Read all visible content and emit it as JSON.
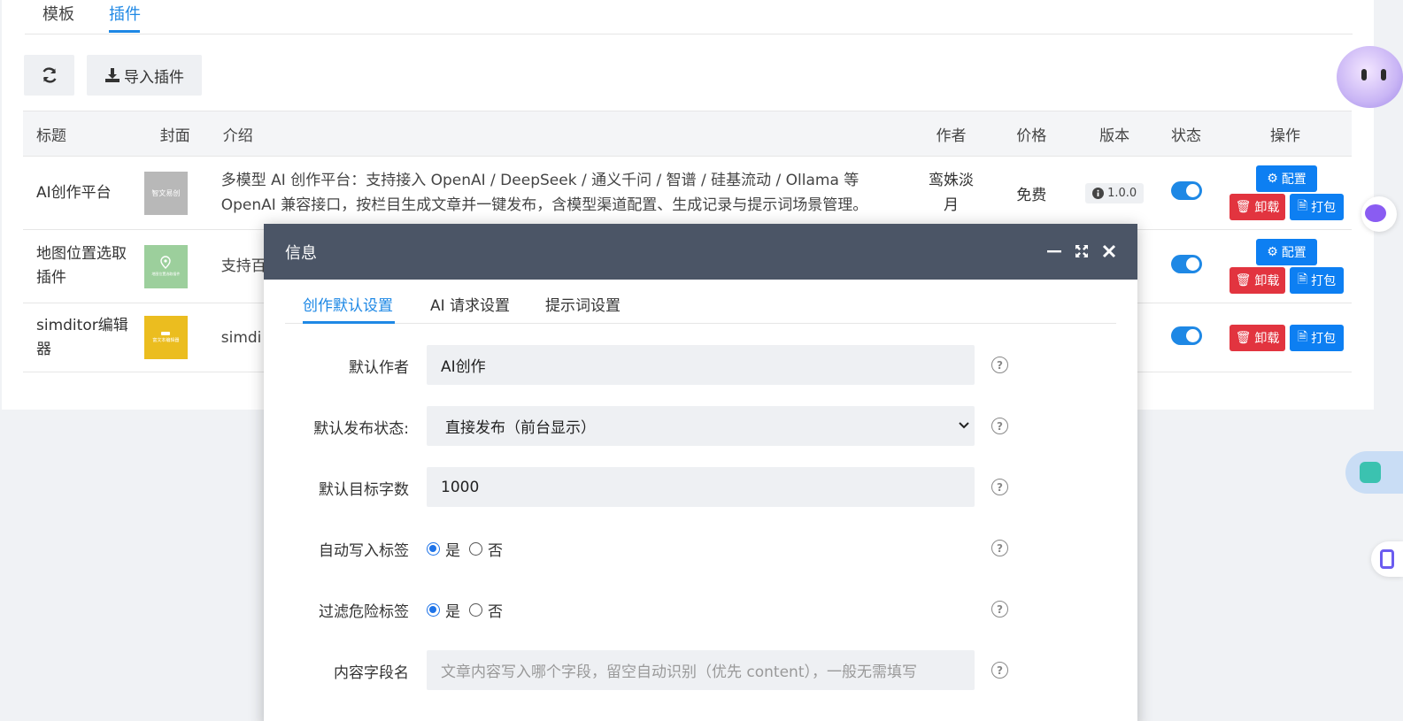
{
  "top_tabs": [
    {
      "label": "模板",
      "active": false
    },
    {
      "label": "插件",
      "active": true
    }
  ],
  "toolbar": {
    "refresh_icon": "refresh-icon",
    "import_label": "导入插件",
    "import_icon": "download-icon"
  },
  "table": {
    "headers": {
      "title": "标题",
      "cover": "封面",
      "intro": "介绍",
      "author": "作者",
      "price": "价格",
      "version": "版本",
      "status": "状态",
      "ops": "操作"
    },
    "rows": [
      {
        "title": "AI创作平台",
        "cover_color": "#b8b8b8",
        "cover_text": "智文易创",
        "intro": "多模型 AI 创作平台：支持接入 OpenAI / DeepSeek / 通义千问 / 智谱 / 硅基流动 / Ollama 等 OpenAI 兼容接口，按栏目生成文章并一键发布，含模型渠道配置、生成记录与提示词场景管理。",
        "author": "鸾姝淡月",
        "price": "免费",
        "version": "1.0.0",
        "enabled": true
      },
      {
        "title": "地图位置选取插件",
        "cover_color": "#9ccf9c",
        "cover_text": "地图位置选取插件",
        "intro": "支持百",
        "enabled": true
      },
      {
        "title": "simditor编辑器",
        "cover_color": "#ebbd1f",
        "cover_text": "富文本编辑器",
        "intro": "simdi",
        "enabled": true
      }
    ],
    "op_labels": {
      "config": "配置",
      "uninstall": "卸载",
      "pack": "打包"
    }
  },
  "dialog": {
    "title": "信息",
    "tabs": [
      {
        "label": "创作默认设置",
        "active": true
      },
      {
        "label": "AI 请求设置",
        "active": false
      },
      {
        "label": "提示词设置",
        "active": false
      }
    ],
    "fields": {
      "default_author": {
        "label": "默认作者",
        "value": "AI创作"
      },
      "publish_status": {
        "label": "默认发布状态:",
        "value": "直接发布（前台显示）"
      },
      "target_words": {
        "label": "默认目标字数",
        "value": "1000"
      },
      "auto_tags": {
        "label": "自动写入标签",
        "yes": "是",
        "no": "否",
        "selected": "是"
      },
      "filter_tags": {
        "label": "过滤危险标签",
        "yes": "是",
        "no": "否",
        "selected": "是"
      },
      "content_field": {
        "label": "内容字段名",
        "value": "",
        "placeholder": "文章内容写入哪个字段，留空自动识别（优先 content），一般无需填写"
      }
    },
    "help_mark": "?"
  }
}
